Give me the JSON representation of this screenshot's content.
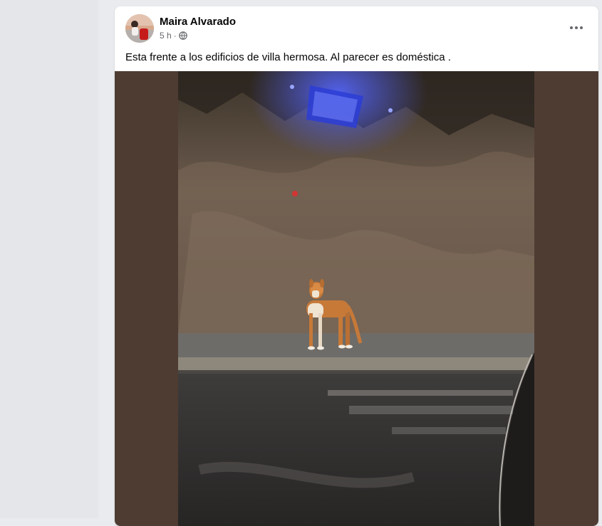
{
  "post": {
    "author": "Maira Alvarado",
    "time": "5 h",
    "separator": "·",
    "privacy_icon": "globe-icon",
    "more_icon": "more-options-icon",
    "caption": "Esta frente a los edificios de villa hermosa. Al parecer es doméstica ."
  },
  "colors": {
    "page_bg": "#e9ebee",
    "media_bg": "#4e3c33",
    "text_primary": "#050505",
    "text_secondary": "#65676b"
  }
}
